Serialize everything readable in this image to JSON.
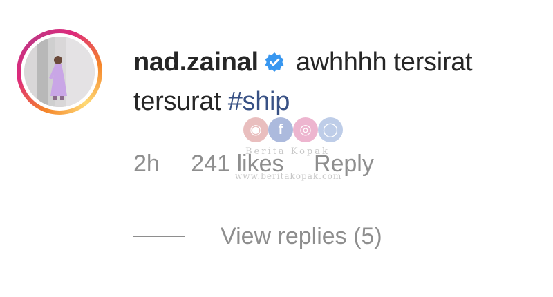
{
  "comment": {
    "avatar": {
      "icon": "profile-photo",
      "ring_colors": [
        "#f58529",
        "#dd2a7b",
        "#c13584"
      ]
    },
    "username": "nad.zainal",
    "verified_icon": "verified-badge-icon",
    "verified_color": "#3897f0",
    "text_before_tag": " awhhhh tersirat tersurat ",
    "hashtag": "#ship",
    "hashtag_color": "#385185",
    "time": "2h",
    "likes": "241 likes",
    "reply_label": "Reply",
    "view_replies_label": "View replies (5)"
  },
  "watermark": {
    "icons": [
      "message-icon",
      "facebook-icon",
      "instagram-icon",
      "globe-icon"
    ],
    "title": "Berita Kopak",
    "url": "www.beritakopak.com"
  }
}
